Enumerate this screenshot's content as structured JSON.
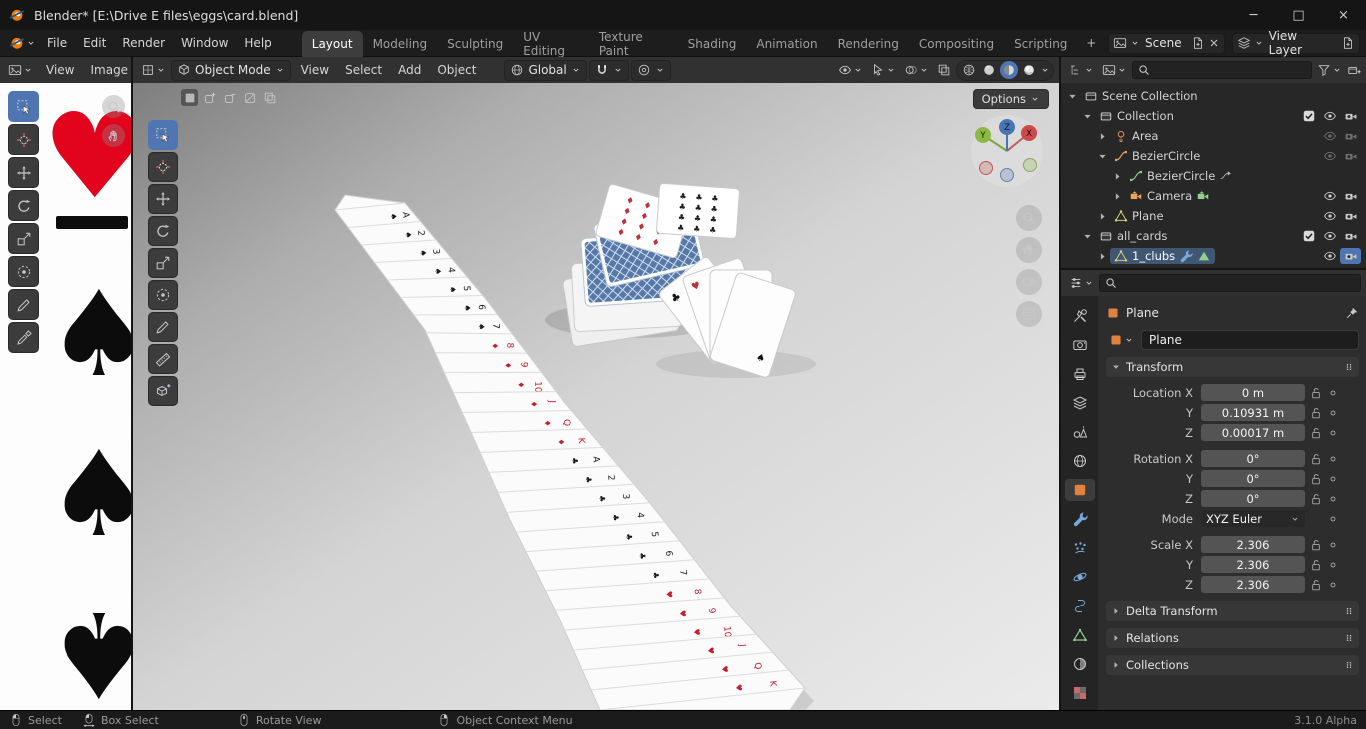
{
  "window": {
    "title": "Blender* [E:\\Drive E files\\eggs\\card.blend]",
    "minimize": "─",
    "maximize": "□",
    "close": "×"
  },
  "topbar": {
    "menus": [
      "File",
      "Edit",
      "Render",
      "Window",
      "Help"
    ],
    "workspaces": [
      "Layout",
      "Modeling",
      "Sculpting",
      "UV Editing",
      "Texture Paint",
      "Shading",
      "Animation",
      "Rendering",
      "Compositing",
      "Scripting"
    ],
    "active_workspace": "Layout",
    "add_workspace": "+",
    "scene": {
      "label": "Scene"
    },
    "view_layer": {
      "label": "View Layer"
    }
  },
  "image_editor": {
    "menus": [
      "View",
      "Image"
    ],
    "tools": [
      "select-box",
      "cursor",
      "move",
      "rotate",
      "scale",
      "transform",
      "annotate",
      "sample"
    ],
    "active_tool": "select-box",
    "card_suits": {
      "heart": "♥",
      "spade": "♠"
    }
  },
  "viewport": {
    "mode": "Object Mode",
    "menus": [
      "View",
      "Select",
      "Add",
      "Object"
    ],
    "orientation": "Global",
    "options": "Options",
    "select_modes": [
      "new",
      "extend",
      "subtract",
      "invert",
      "intersect"
    ],
    "tools": [
      "select-box",
      "cursor",
      "move",
      "rotate",
      "scale",
      "transform",
      "annotate",
      "measure",
      "add-cube"
    ],
    "active_tool": "select-box",
    "gizmo": {
      "x": "X",
      "y": "Y",
      "z": "Z"
    }
  },
  "outliner": {
    "rows": [
      {
        "indent": 0,
        "exp": "down",
        "icon": "scene-collection",
        "label": "Scene Collection"
      },
      {
        "indent": 1,
        "exp": "down",
        "icon": "collection",
        "label": "Collection",
        "check": true,
        "eye": true,
        "cam": true
      },
      {
        "indent": 2,
        "exp": "right",
        "icon": "light",
        "label": "Area",
        "dim": true,
        "eye": true,
        "cam": true
      },
      {
        "indent": 2,
        "exp": "down",
        "icon": "curve",
        "label": "BezierCircle",
        "dim": true,
        "eye": true,
        "cam": true
      },
      {
        "indent": 3,
        "exp": "right",
        "icon": "curve-data",
        "label": "BezierCircle",
        "extra": [
          "driver"
        ]
      },
      {
        "indent": 3,
        "exp": "right",
        "icon": "camera-obj",
        "label": "Camera",
        "extra": [
          "camera-data"
        ],
        "eye": true,
        "cam": true
      },
      {
        "indent": 2,
        "exp": "right",
        "icon": "mesh",
        "label": "Plane",
        "eye": true,
        "cam": true
      },
      {
        "indent": 1,
        "exp": "down",
        "icon": "collection",
        "label": "all_cards",
        "check": true,
        "eye": true,
        "cam": true
      },
      {
        "indent": 2,
        "exp": "right",
        "icon": "mesh",
        "label": "1_clubs",
        "selected": true,
        "extra": [
          "modifier",
          "mesh-data"
        ],
        "eye": true,
        "cam": true,
        "camActive": true
      }
    ]
  },
  "properties": {
    "tabs": [
      "tool",
      "render",
      "output",
      "view-layer",
      "scene",
      "world",
      "object",
      "modifiers",
      "particles",
      "physics",
      "constraints",
      "data",
      "material",
      "texture"
    ],
    "active_tab": "object",
    "breadcrumb": "Plane",
    "object_name": "Plane",
    "transform_label": "Transform",
    "transform_rows": [
      {
        "label": "Location X",
        "value": "0 m",
        "type": "field"
      },
      {
        "label": "Y",
        "value": "0.10931 m",
        "type": "field"
      },
      {
        "label": "Z",
        "value": "0.00017 m",
        "type": "field"
      },
      {
        "label": "Rotation X",
        "value": "0°",
        "type": "field",
        "group": true
      },
      {
        "label": "Y",
        "value": "0°",
        "type": "field"
      },
      {
        "label": "Z",
        "value": "0°",
        "type": "field"
      },
      {
        "label": "Mode",
        "value": "XYZ Euler",
        "type": "dropdown"
      },
      {
        "label": "Scale X",
        "value": "2.306",
        "type": "field",
        "group": true
      },
      {
        "label": "Y",
        "value": "2.306",
        "type": "field"
      },
      {
        "label": "Z",
        "value": "2.306",
        "type": "field"
      }
    ],
    "collapsed_sections": [
      "Delta Transform",
      "Relations",
      "Collections"
    ]
  },
  "statusbar": {
    "hints": [
      {
        "icon": "mouse-left",
        "label": "Select"
      },
      {
        "icon": "mouse-drag",
        "label": "Box Select"
      },
      {
        "icon": "mouse-middle",
        "label": "Rotate View"
      },
      {
        "icon": "mouse-right",
        "label": "Object Context Menu"
      }
    ],
    "version": "3.1.0 Alpha"
  }
}
